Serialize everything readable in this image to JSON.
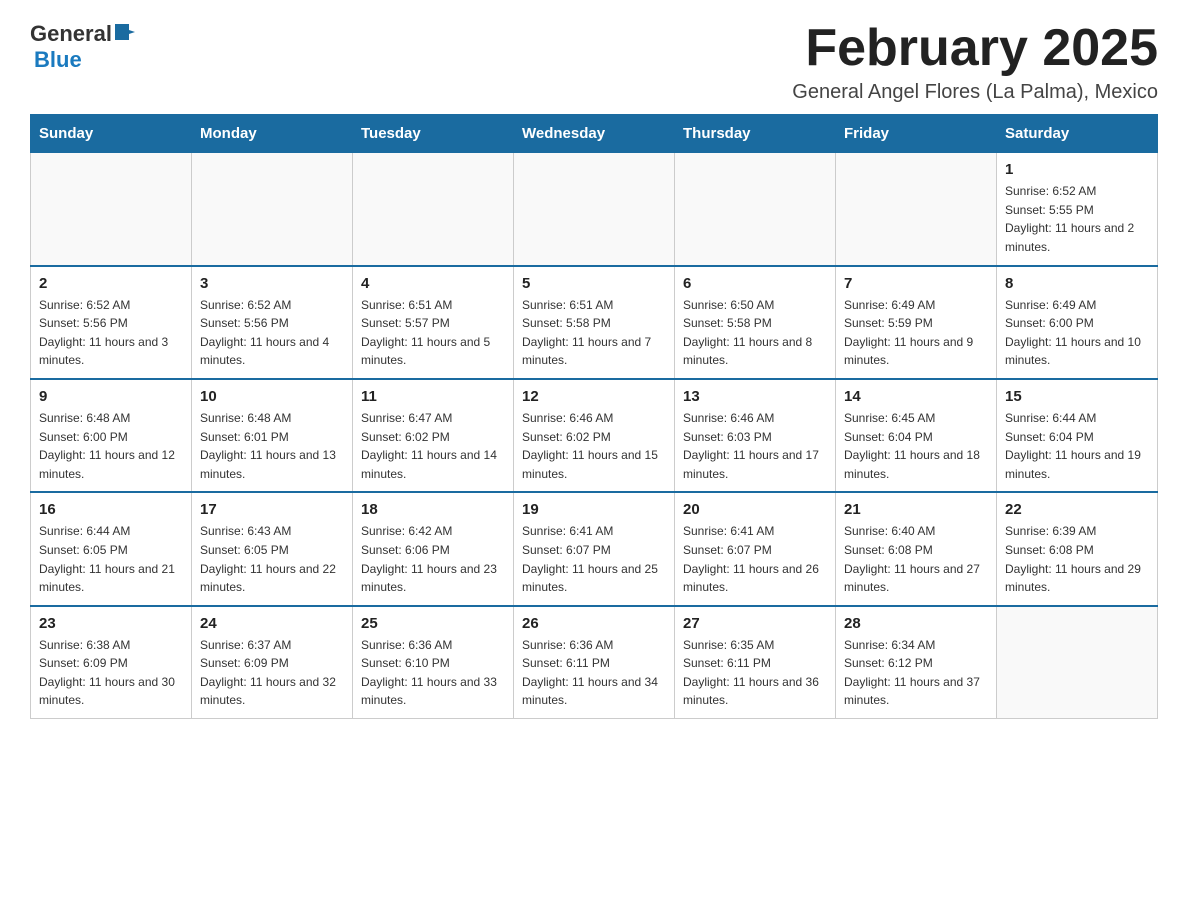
{
  "header": {
    "logo_text_general": "General",
    "logo_text_blue": "Blue",
    "month_title": "February 2025",
    "location": "General Angel Flores (La Palma), Mexico"
  },
  "days_of_week": [
    "Sunday",
    "Monday",
    "Tuesday",
    "Wednesday",
    "Thursday",
    "Friday",
    "Saturday"
  ],
  "weeks": [
    [
      {
        "day": "",
        "info": ""
      },
      {
        "day": "",
        "info": ""
      },
      {
        "day": "",
        "info": ""
      },
      {
        "day": "",
        "info": ""
      },
      {
        "day": "",
        "info": ""
      },
      {
        "day": "",
        "info": ""
      },
      {
        "day": "1",
        "info": "Sunrise: 6:52 AM\nSunset: 5:55 PM\nDaylight: 11 hours and 2 minutes."
      }
    ],
    [
      {
        "day": "2",
        "info": "Sunrise: 6:52 AM\nSunset: 5:56 PM\nDaylight: 11 hours and 3 minutes."
      },
      {
        "day": "3",
        "info": "Sunrise: 6:52 AM\nSunset: 5:56 PM\nDaylight: 11 hours and 4 minutes."
      },
      {
        "day": "4",
        "info": "Sunrise: 6:51 AM\nSunset: 5:57 PM\nDaylight: 11 hours and 5 minutes."
      },
      {
        "day": "5",
        "info": "Sunrise: 6:51 AM\nSunset: 5:58 PM\nDaylight: 11 hours and 7 minutes."
      },
      {
        "day": "6",
        "info": "Sunrise: 6:50 AM\nSunset: 5:58 PM\nDaylight: 11 hours and 8 minutes."
      },
      {
        "day": "7",
        "info": "Sunrise: 6:49 AM\nSunset: 5:59 PM\nDaylight: 11 hours and 9 minutes."
      },
      {
        "day": "8",
        "info": "Sunrise: 6:49 AM\nSunset: 6:00 PM\nDaylight: 11 hours and 10 minutes."
      }
    ],
    [
      {
        "day": "9",
        "info": "Sunrise: 6:48 AM\nSunset: 6:00 PM\nDaylight: 11 hours and 12 minutes."
      },
      {
        "day": "10",
        "info": "Sunrise: 6:48 AM\nSunset: 6:01 PM\nDaylight: 11 hours and 13 minutes."
      },
      {
        "day": "11",
        "info": "Sunrise: 6:47 AM\nSunset: 6:02 PM\nDaylight: 11 hours and 14 minutes."
      },
      {
        "day": "12",
        "info": "Sunrise: 6:46 AM\nSunset: 6:02 PM\nDaylight: 11 hours and 15 minutes."
      },
      {
        "day": "13",
        "info": "Sunrise: 6:46 AM\nSunset: 6:03 PM\nDaylight: 11 hours and 17 minutes."
      },
      {
        "day": "14",
        "info": "Sunrise: 6:45 AM\nSunset: 6:04 PM\nDaylight: 11 hours and 18 minutes."
      },
      {
        "day": "15",
        "info": "Sunrise: 6:44 AM\nSunset: 6:04 PM\nDaylight: 11 hours and 19 minutes."
      }
    ],
    [
      {
        "day": "16",
        "info": "Sunrise: 6:44 AM\nSunset: 6:05 PM\nDaylight: 11 hours and 21 minutes."
      },
      {
        "day": "17",
        "info": "Sunrise: 6:43 AM\nSunset: 6:05 PM\nDaylight: 11 hours and 22 minutes."
      },
      {
        "day": "18",
        "info": "Sunrise: 6:42 AM\nSunset: 6:06 PM\nDaylight: 11 hours and 23 minutes."
      },
      {
        "day": "19",
        "info": "Sunrise: 6:41 AM\nSunset: 6:07 PM\nDaylight: 11 hours and 25 minutes."
      },
      {
        "day": "20",
        "info": "Sunrise: 6:41 AM\nSunset: 6:07 PM\nDaylight: 11 hours and 26 minutes."
      },
      {
        "day": "21",
        "info": "Sunrise: 6:40 AM\nSunset: 6:08 PM\nDaylight: 11 hours and 27 minutes."
      },
      {
        "day": "22",
        "info": "Sunrise: 6:39 AM\nSunset: 6:08 PM\nDaylight: 11 hours and 29 minutes."
      }
    ],
    [
      {
        "day": "23",
        "info": "Sunrise: 6:38 AM\nSunset: 6:09 PM\nDaylight: 11 hours and 30 minutes."
      },
      {
        "day": "24",
        "info": "Sunrise: 6:37 AM\nSunset: 6:09 PM\nDaylight: 11 hours and 32 minutes."
      },
      {
        "day": "25",
        "info": "Sunrise: 6:36 AM\nSunset: 6:10 PM\nDaylight: 11 hours and 33 minutes."
      },
      {
        "day": "26",
        "info": "Sunrise: 6:36 AM\nSunset: 6:11 PM\nDaylight: 11 hours and 34 minutes."
      },
      {
        "day": "27",
        "info": "Sunrise: 6:35 AM\nSunset: 6:11 PM\nDaylight: 11 hours and 36 minutes."
      },
      {
        "day": "28",
        "info": "Sunrise: 6:34 AM\nSunset: 6:12 PM\nDaylight: 11 hours and 37 minutes."
      },
      {
        "day": "",
        "info": ""
      }
    ]
  ]
}
